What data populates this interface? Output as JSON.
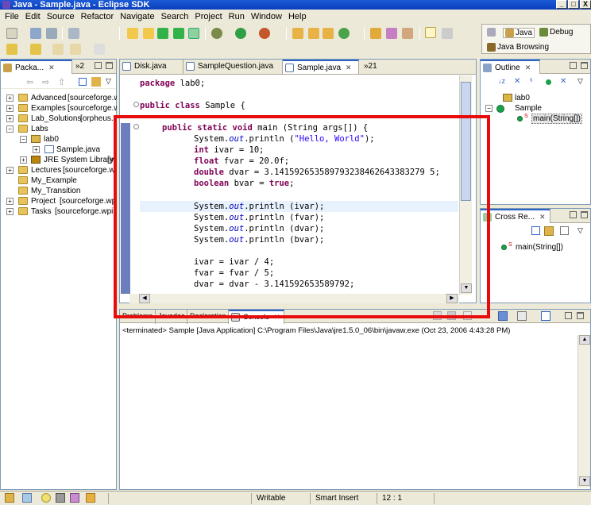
{
  "window": {
    "title": "Java - Sample.java - Eclipse SDK",
    "minimize": "_",
    "maximize": "□",
    "close": "X"
  },
  "menu": [
    "File",
    "Edit",
    "Source",
    "Refactor",
    "Navigate",
    "Search",
    "Project",
    "Run",
    "Window",
    "Help"
  ],
  "perspectives": {
    "java": "Java",
    "debug": "Debug",
    "java_browsing": "Java Browsing"
  },
  "package_explorer": {
    "tab_label": "Packa...",
    "overflow_count": "»2",
    "items": [
      {
        "label": "Advanced",
        "detail": "[sourceforge.w"
      },
      {
        "label": "Examples",
        "detail": "[sourceforge.w"
      },
      {
        "label": "Lab_Solutions",
        "detail": "[orpheus."
      },
      {
        "label": "Labs",
        "detail": ""
      },
      {
        "label": "lab0",
        "detail": ""
      },
      {
        "label": "Sample.java",
        "detail": ""
      },
      {
        "label": "JRE System Library",
        "detail": "[jr"
      },
      {
        "label": "Lectures",
        "detail": "[sourceforge.wp"
      },
      {
        "label": "My_Example",
        "detail": ""
      },
      {
        "label": "My_Transition",
        "detail": ""
      },
      {
        "label": "Project",
        "detail": "[sourceforge.wp"
      },
      {
        "label": "Tasks",
        "detail": "[sourceforge.wpi."
      }
    ]
  },
  "editor": {
    "tabs": [
      {
        "label": "Disk.java"
      },
      {
        "label": "SampleQuestion.java"
      },
      {
        "label": "Sample.java",
        "active": true
      }
    ],
    "tab_overflow": "»21",
    "code": {
      "package_kw": "package",
      "package_name": " lab0;",
      "class_line": {
        "kw1": "public",
        "kw2": "class",
        "rest": " Sample {"
      },
      "main_line": {
        "kw1": "public",
        "kw2": "static",
        "kw3": "void",
        "rest": " main (String args[]) {"
      },
      "println_hello": {
        "pre": "System.",
        "out": "out",
        "mid": ".println (",
        "str": "\"Hello, World\"",
        "post": ");"
      },
      "int_line": {
        "kw": "int",
        "rest": " ivar = 10;"
      },
      "float_line": {
        "kw": "float",
        "rest": " fvar = 20.0f;"
      },
      "double_line": {
        "kw": "double",
        "rest": " dvar = 3.141592653589793238462643383279 5;"
      },
      "boolean_line": {
        "kw": "boolean",
        "rest": " bvar = ",
        "val": "true",
        "end": ";"
      },
      "println_ivar": {
        "pre": "System.",
        "out": "out",
        "post": ".println (ivar);"
      },
      "println_fvar": {
        "pre": "System.",
        "out": "out",
        "post": ".println (fvar);"
      },
      "println_dvar": {
        "pre": "System.",
        "out": "out",
        "post": ".println (dvar);"
      },
      "println_bvar": {
        "pre": "System.",
        "out": "out",
        "post": ".println (bvar);"
      },
      "ivar_div": "ivar = ivar / 4;",
      "fvar_div": "fvar = fvar / 5;",
      "dvar_sub": "dvar = dvar - 3.141592653589792;"
    }
  },
  "outline": {
    "tab_label": "Outline",
    "items": [
      {
        "label": "lab0"
      },
      {
        "label": "Sample"
      },
      {
        "label": "main(String[])"
      }
    ]
  },
  "cross_ref": {
    "tab_label": "Cross Re...",
    "items": [
      {
        "label": "main(String[])"
      }
    ]
  },
  "console": {
    "tabs": [
      "Problems",
      "Javadoc",
      "Declaration",
      "Console"
    ],
    "text": "<terminated> Sample [Java Application] C:\\Program Files\\Java\\jre1.5.0_06\\bin\\javaw.exe (Oct 23, 2006 4:43:28 PM)"
  },
  "status": {
    "writable": "Writable",
    "insert_mode": "Smart Insert",
    "position": "12 : 1"
  },
  "colors": {
    "highlight": "#e80b0b",
    "keyword": "#7f0055",
    "string": "#2a00ff",
    "field": "#0000c0"
  }
}
